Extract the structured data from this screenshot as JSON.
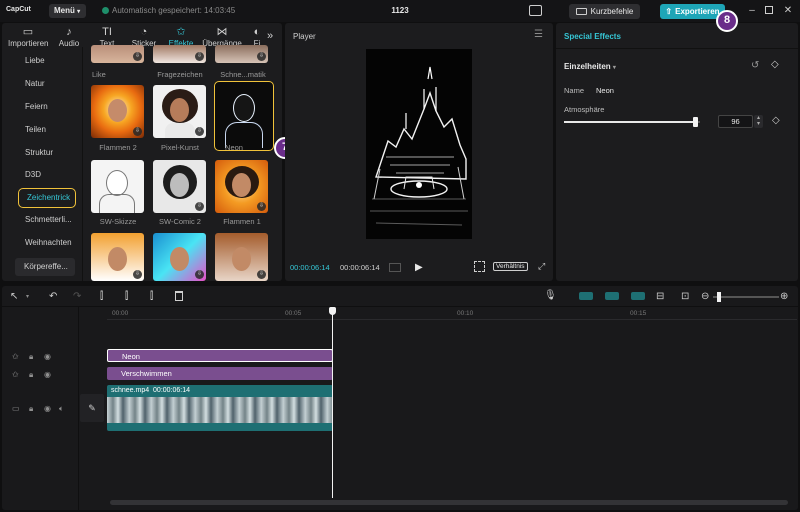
{
  "titlebar": {
    "logo": "CapCut",
    "menu": "Menü",
    "autosave": "Automatisch gespeichert: 14:03:45",
    "project": "1123",
    "shortcuts": "Kurzbefehle",
    "export": "Exportieren",
    "export_badge": "8"
  },
  "tabs": [
    {
      "label": "Importieren",
      "icon": "import-icon"
    },
    {
      "label": "Audio",
      "icon": "audio-icon"
    },
    {
      "label": "Text",
      "icon": "text-icon"
    },
    {
      "label": "Sticker",
      "icon": "sticker-icon"
    },
    {
      "label": "Effekte",
      "icon": "effects-icon",
      "active": true
    },
    {
      "label": "Übergänge",
      "icon": "transitions-icon"
    },
    {
      "label": "Fi",
      "icon": "filter-icon"
    }
  ],
  "categories": [
    "Liebe",
    "Natur",
    "Feiern",
    "Teilen",
    "Struktur",
    "D3D",
    "Zeichentrick",
    "Schmetterli...",
    "Weihnachten",
    "Körpereffe..."
  ],
  "effects": {
    "top_labels": [
      "Like",
      "Fragezeichen",
      "Schne...matik"
    ],
    "row1": [
      "Flammen 2",
      "Pixel-Kunst",
      "Neon"
    ],
    "row2": [
      "SW-Skizze",
      "SW-Comic 2",
      "Flammen 1"
    ],
    "neon_badge": "7"
  },
  "player": {
    "title": "Player",
    "time_current": "00:00:06:14",
    "time_total": "00:00:06:14",
    "ratio": "Verhältnis"
  },
  "special": {
    "title": "Special Effects",
    "section": "Einzelheiten",
    "name_label": "Name",
    "name_value": "Neon",
    "atmo_label": "Atmosphäre",
    "atmo_value": "96",
    "atmo_level": 0.96
  },
  "timeline": {
    "ruler": [
      "00:00",
      "00:05",
      "00:10",
      "00:15"
    ],
    "tracks": [
      {
        "label": "Neon"
      },
      {
        "label": "Verschwimmen"
      }
    ],
    "clip_name": "schnee.mp4",
    "clip_duration": "00:00:06:14"
  },
  "colors": {
    "accent": "#36c7d6",
    "highlight": "#f0c23a",
    "badge": "#6a2d8a",
    "effect_track": "#7a4e8f",
    "video_track": "#1e6f73"
  }
}
